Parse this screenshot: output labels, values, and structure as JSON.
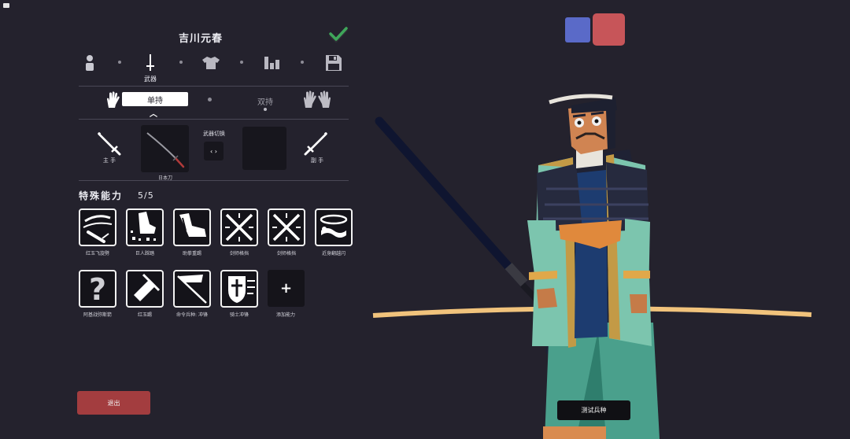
{
  "unit": {
    "name": "吉川元春"
  },
  "tabs": [
    {
      "icon": "person-icon",
      "label": ""
    },
    {
      "icon": "sword-icon",
      "label": "武器"
    },
    {
      "icon": "shirt-icon",
      "label": ""
    },
    {
      "icon": "stats-icon",
      "label": ""
    },
    {
      "icon": "save-icon",
      "label": ""
    }
  ],
  "grip": {
    "one_hand": "单持",
    "two_hand": "双持",
    "selected": "单持"
  },
  "weapons": {
    "main_hand_label": "主 手",
    "off_hand_label": "副 手",
    "weapon_name": "日本刀",
    "switch_label": "武器切换",
    "switch_symbol": "‹ ›"
  },
  "abilities": {
    "title": "特殊能力",
    "count": "5/5",
    "items": [
      {
        "label": "红玉飞旋劈",
        "icon": "spin-slash-icon"
      },
      {
        "label": "巨人踩踏",
        "icon": "stomp-icon"
      },
      {
        "label": "助拳重踢",
        "icon": "kick-icon"
      },
      {
        "label": "剑师格挡",
        "icon": "parry-icon"
      },
      {
        "label": "剑师格挡",
        "icon": "parry-icon"
      },
      {
        "label": "近身翻越闪",
        "icon": "dodge-icon"
      },
      {
        "label": "阿基战弥斯箭",
        "icon": "question-icon"
      },
      {
        "label": "红玉踢",
        "icon": "gem-kick-icon"
      },
      {
        "label": "命令兵种: 冲锋",
        "icon": "flag-icon"
      },
      {
        "label": "骑士冲锋",
        "icon": "knight-charge-icon"
      }
    ],
    "add_symbol": "+",
    "add_label": "添加能力"
  },
  "buttons": {
    "exit": "退出",
    "test_unit": "测试兵种"
  },
  "colors": {
    "background": "#24222d",
    "team_blue": "#5a6ac8",
    "team_red": "#c75559",
    "exit_button": "#a33d3f"
  }
}
